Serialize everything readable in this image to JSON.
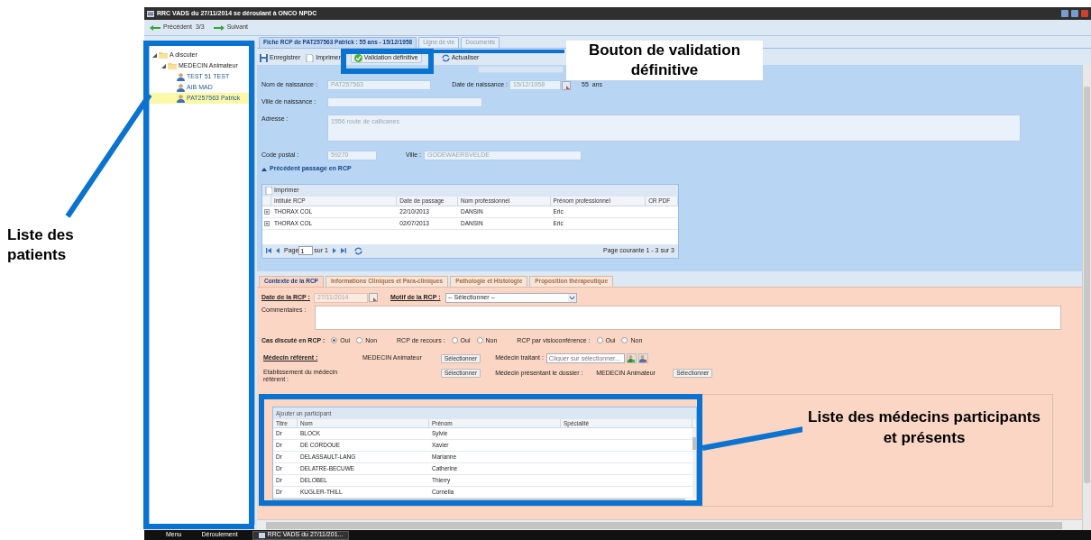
{
  "window": {
    "title": "RRC VADS du 27/11/2014 se déroulant à ONCO NPDC"
  },
  "nav": {
    "previous": "Précédent",
    "counter": "3/3",
    "next": "Suivant"
  },
  "tree": [
    {
      "label": "A discuter",
      "kind": "folder",
      "expanded": true,
      "selected": false,
      "children": [
        {
          "label": "MEDECIN Animateur",
          "kind": "folder",
          "expanded": true,
          "selected": false,
          "children": [
            {
              "label": "TEST 51 TEST",
              "kind": "patient",
              "selected": false
            },
            {
              "label": "AIB MAD",
              "kind": "patient",
              "selected": false
            },
            {
              "label": "PAT257563 Patrick",
              "kind": "patient",
              "selected": true
            }
          ]
        }
      ]
    }
  ],
  "main_tabs": [
    {
      "label": "Fiche RCP de PAT257563 Patrick : 55 ans - 15/12/1958",
      "selected": true
    },
    {
      "label": "Ligne de vie",
      "selected": false
    },
    {
      "label": "Documents",
      "selected": false
    }
  ],
  "toolbar": [
    {
      "label": "Enregistrer",
      "kind": "save"
    },
    {
      "label": "Imprimer",
      "kind": "print"
    },
    {
      "label": "Validation définitive",
      "kind": "validate"
    },
    {
      "label": "Actualiser",
      "kind": "refresh"
    }
  ],
  "identity": {
    "birth_name": {
      "label": "Nom de naissance :",
      "value": "PAT257563"
    },
    "birth_date": {
      "label": "Date de naissance :",
      "value": "15/12/1958"
    },
    "age": "55  ans",
    "birth_city": {
      "label": "Ville de naissance :"
    },
    "address": {
      "label": "Adresse :",
      "value": "1556 route de callicanes"
    },
    "postal_code": {
      "label": "Code postal :",
      "value": "59270"
    },
    "city": {
      "label": "Ville :",
      "value": "GODEWAERSVELDE"
    }
  },
  "previous_rcp": {
    "title": "Précédent passage en RCP",
    "expanded": true,
    "toolbar_button": "Imprimer",
    "columns": [
      "Intitulé RCP",
      "Date de passage",
      "Nom professionnel",
      "Prénom professionnel",
      "CR PDF"
    ],
    "rows": [
      [
        "THORAX COL",
        "22/10/2013",
        "DANSIN",
        "Eric",
        ""
      ],
      [
        "THORAX COL",
        "02/07/2013",
        "DANSIN",
        "Eric",
        ""
      ]
    ],
    "pager": {
      "page_label": "Page",
      "page": "1",
      "of": "sur 1",
      "summary": "Page courante 1 - 3 sur 3"
    }
  },
  "section_tabs": [
    {
      "label": "Contexte de la RCP",
      "selected": true
    },
    {
      "label": "Informations Cliniques et Para-cliniques",
      "selected": false
    },
    {
      "label": "Pathologie et Histologie",
      "selected": false
    },
    {
      "label": "Proposition thérapeutique",
      "selected": false
    }
  ],
  "rcp_date": {
    "label": "Date de la RCP :",
    "value": "27/11/2014"
  },
  "rcp_reason": {
    "label": "Motif de la RCP :",
    "value": "-- Sélectionner --"
  },
  "comments": {
    "label": "Commentaires :"
  },
  "radio_groups": [
    {
      "label": "Cas discuté en RCP :",
      "options": [
        {
          "label": "Oui",
          "selected": true
        },
        {
          "label": "Non",
          "selected": false
        }
      ]
    },
    {
      "label": "RCP de recours :",
      "options": [
        {
          "label": "Oui",
          "selected": false
        },
        {
          "label": "Non",
          "selected": false
        }
      ]
    },
    {
      "label": "RCP par visioconférence :",
      "options": [
        {
          "label": "Oui",
          "selected": false
        },
        {
          "label": "Non",
          "selected": false
        }
      ]
    }
  ],
  "referent": {
    "label": "Médecin référent :",
    "value": "MEDECIN Animateur",
    "button": "Sélectionner"
  },
  "treating": {
    "label": "Médecin traitant :",
    "placeholder": "Cliquer sur sélectionner..."
  },
  "establishment": {
    "label": "Etablissement du médecin référent :",
    "button": "Sélectionner"
  },
  "presenting": {
    "label": "Médecin présentant le dossier :",
    "value": "MEDECIN Animateur",
    "button": "Sélectionner"
  },
  "participants": {
    "toolbar_button": "Ajouter un participant",
    "columns": [
      "Titre",
      "Nom",
      "Prénom",
      "Spécialité"
    ],
    "rows": [
      [
        "Dr",
        "BLOCK",
        "Sylvie",
        ""
      ],
      [
        "Dr",
        "DE CORDOUE",
        "Xavier",
        ""
      ],
      [
        "Dr",
        "DELASSAULT-LANG",
        "Marianne",
        ""
      ],
      [
        "Dr",
        "DELATRE-BECUWE",
        "Catherine",
        ""
      ],
      [
        "Dr",
        "DELOBEL",
        "Thierry",
        ""
      ],
      [
        "Dr",
        "KUGLER-THILL",
        "Cornelia",
        ""
      ]
    ]
  },
  "taskbar": [
    "Menu",
    "Déroulement",
    "RRC VADS du 27/11/201..."
  ],
  "annotations": [
    {
      "text": "Liste des patients"
    },
    {
      "text": "Bouton de validation définitive"
    },
    {
      "text": "Liste des médecins participants et présents"
    }
  ]
}
